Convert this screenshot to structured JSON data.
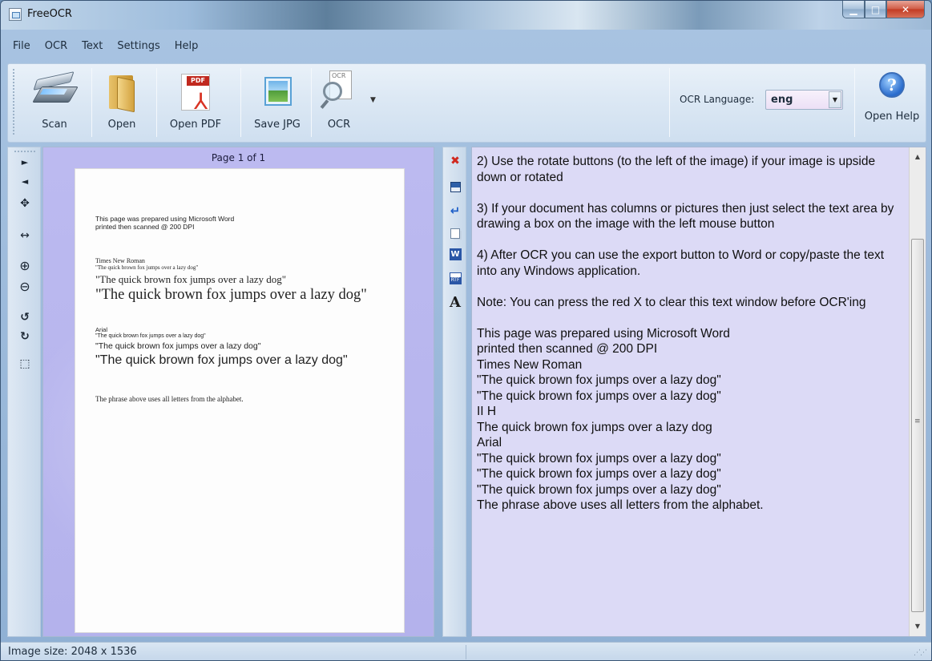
{
  "window": {
    "title": "FreeOCR"
  },
  "menu": [
    "File",
    "OCR",
    "Text",
    "Settings",
    "Help"
  ],
  "toolbar": {
    "scan_label": "Scan",
    "open_label": "Open",
    "open_pdf_label": "Open PDF",
    "save_jpg_label": "Save JPG",
    "ocr_label": "OCR",
    "pdf_tag": "PDF",
    "ocr_tag": "OCR",
    "ocr_language_label": "OCR Language:",
    "ocr_language_value": "eng",
    "open_help_label": "Open Help"
  },
  "viewer": {
    "page_label": "Page 1 of 1",
    "page_lines": [
      "This page was prepared using Microsoft Word",
      "printed then scanned @ 200 DPI",
      "Times New Roman",
      "\"The quick brown fox jumps over a lazy dog\"",
      "\"The quick brown fox jumps over a lazy dog\"",
      "\"The quick brown fox jumps over a lazy dog\"",
      "Arial",
      "\"The quick brown fox jumps over a lazy dog\"",
      "\"The quick brown fox  jumps over a lazy dog\"",
      "\"The quick brown fox jumps over a lazy dog\"",
      "The phrase above uses all letters from the alphabet."
    ]
  },
  "text_output": "2) Use the rotate buttons (to the left of the image) if your image is upside down or rotated\n\n3) If your document has columns or pictures then just select the text area by drawing a box on the image with the left mouse button\n\n4) After OCR you can use the export button to Word or copy/paste the text into any Windows application.\n\nNote: You can press the red X to clear this text window before OCR'ing\n\nThis page was prepared using Microsoft Word\nprinted then scanned @ 200 DPI\nTimes New Roman\n\"The quick brown fox jumps over a lazy dog\"\n\"The quick brown fox jumps over a lazy dog\"\nII H\nThe quick brown fox jumps over a lazy dog\nArial\n\"The quick brown fox jumps over a lazy dog\"\n\"The quick brown fox jumps over a lazy dog\"\n\"The quick brown fox jumps over a lazy dog\"\nThe phrase above uses all letters from the alphabet.",
  "status": {
    "image_size": "Image size:  2048 x 1536"
  },
  "colors": {
    "viewer_bg": "#b9b7ef",
    "text_bg": "#dcdaf6",
    "accent": "#2a6ccd"
  },
  "icons": {
    "left_tools": [
      "next-page-icon",
      "prev-page-icon",
      "pan-icon",
      "fit-width-icon",
      "zoom-in-icon",
      "zoom-out-icon",
      "rotate-left-icon",
      "rotate-right-icon",
      "select-area-icon"
    ],
    "text_tools": [
      "clear-text-icon",
      "save-text-icon",
      "remove-linebreaks-icon",
      "copy-text-icon",
      "export-word-icon",
      "export-rtf-icon",
      "font-icon"
    ]
  }
}
